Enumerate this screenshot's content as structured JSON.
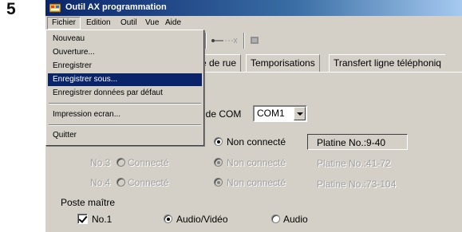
{
  "step_number": "5",
  "window": {
    "title": "Outil AX programmation",
    "title_bar_color": "#0a246a"
  },
  "menubar": {
    "items": [
      {
        "label": "Fichier",
        "active": true
      },
      {
        "label": "Edition",
        "active": false
      },
      {
        "label": "Outil",
        "active": false
      },
      {
        "label": "Vue",
        "active": false
      },
      {
        "label": "Aide",
        "active": false
      }
    ]
  },
  "file_menu": {
    "items": [
      {
        "label": "Nouveau",
        "highlighted": false
      },
      {
        "label": "Ouverture...",
        "highlighted": false
      },
      {
        "label": "Enregistrer",
        "highlighted": false
      },
      {
        "label": "Enregistrer sous...",
        "highlighted": true
      },
      {
        "label": "Enregistrer données par défaut",
        "highlighted": false
      },
      {
        "label": "Impression ecran...",
        "highlighted": false
      },
      {
        "label": "Quitter",
        "highlighted": false
      }
    ],
    "highlight_color": "#0a246a"
  },
  "tabs": {
    "items": [
      {
        "label": "e de rue"
      },
      {
        "label": "Temporisations"
      },
      {
        "label": "Transfert ligne téléphoniq"
      }
    ]
  },
  "com_port": {
    "label": "rt de COM",
    "value": "COM1"
  },
  "rows": [
    {
      "no": "",
      "connecte": "",
      "non_connecte": "Non connecté",
      "platine": "Platine No.:9-40",
      "enabled": true,
      "selected": "non_connecte"
    },
    {
      "no": "No.3",
      "connecte": "Connecté",
      "non_connecte": "Non connecté",
      "platine": "Platine No.:41-72",
      "enabled": false,
      "selected": "non_connecte"
    },
    {
      "no": "No.4",
      "connecte": "Connecté",
      "non_connecte": "Non connecté",
      "platine": "Platine No.:73-104",
      "enabled": false,
      "selected": "non_connecte"
    }
  ],
  "poste_maitre": {
    "label": "Poste maître",
    "checkbox_label": "No.1",
    "checkbox_checked": true,
    "option_av": "Audio/Vidéo",
    "option_audio": "Audio",
    "selected": "av"
  }
}
